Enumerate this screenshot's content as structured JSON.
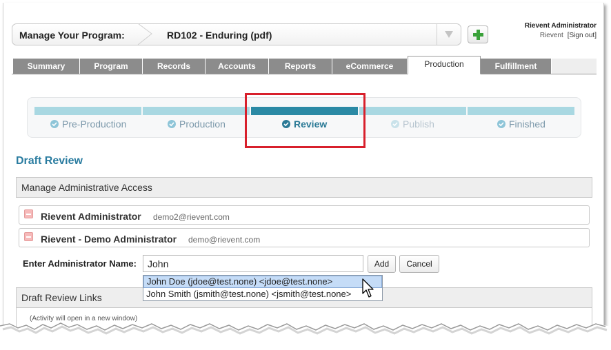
{
  "header": {
    "manage_label": "Manage Your Program:",
    "program_value": "RD102 - Enduring (pdf)",
    "user_name": "Rievent Administrator",
    "user_org": "Rievent",
    "sign_out": "[Sign out]"
  },
  "tabs": [
    {
      "label": "Summary"
    },
    {
      "label": "Program"
    },
    {
      "label": "Records"
    },
    {
      "label": "Accounts"
    },
    {
      "label": "Reports"
    },
    {
      "label": "eCommerce"
    },
    {
      "label": "Production",
      "active": true
    },
    {
      "label": "Fulfillment"
    }
  ],
  "steps": [
    {
      "label": "Pre-Production",
      "state": "done"
    },
    {
      "label": "Production",
      "state": "done"
    },
    {
      "label": "Review",
      "state": "active"
    },
    {
      "label": "Publish",
      "state": "pending"
    },
    {
      "label": "Finished",
      "state": "done"
    }
  ],
  "draft": {
    "title": "Draft Review",
    "access_header": "Manage Administrative Access",
    "admins": [
      {
        "name": "Rievent Administrator",
        "email": "demo2@rievent.com"
      },
      {
        "name": "Rievent - Demo Administrator",
        "email": "demo@rievent.com"
      }
    ],
    "enter_label": "Enter Administrator Name:",
    "input_value": "John",
    "add_label": "Add",
    "cancel_label": "Cancel",
    "suggestions": [
      "John Doe (jdoe@test.none) <jdoe@test.none>",
      "John Smith (jsmith@test.none) <jsmith@test.none>"
    ],
    "links_header": "Draft Review Links",
    "links_note": "(Activity will open in a new window)"
  },
  "colors": {
    "accent": "#2a7ca0",
    "step_active": "#2b8aa5",
    "step_bar": "#a9d8e2",
    "tab_bg": "#8c8c8c",
    "highlight_box": "#d8202c",
    "add_icon": "#3aa13a"
  }
}
